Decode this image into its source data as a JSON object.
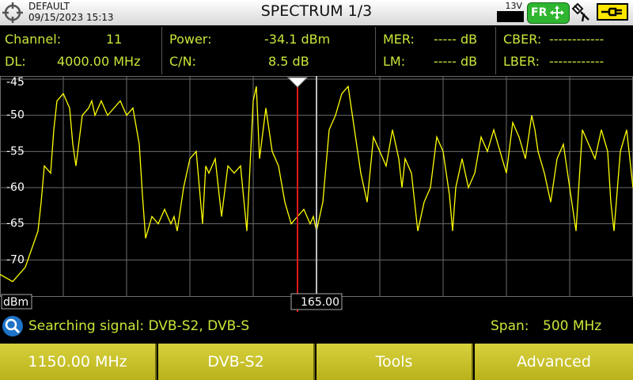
{
  "header": {
    "profile": "DEFAULT",
    "datetime": "09/15/2023 15:13",
    "title": "SPECTRUM 1/3",
    "lnb_voltage": "13V",
    "fr_label": "FR"
  },
  "measurements": {
    "channel_label": "Channel:",
    "channel_value": "11",
    "dl_label": "DL:",
    "dl_value": "4000.00 MHz",
    "power_label": "Power:",
    "power_value": "-34.1 dBm",
    "cn_label": "C/N:",
    "cn_value": "8.5 dB",
    "mer_label": "MER:",
    "mer_value": "----- dB",
    "lm_label": "LM:",
    "lm_value": "----- dB",
    "cber_label": "CBER:",
    "cber_value": "------------",
    "lber_label": "LBER:",
    "lber_value": "------------"
  },
  "chart_data": {
    "type": "line",
    "ylabel": "dBm",
    "ylim": [
      -75,
      -45
    ],
    "yticks": [
      -45,
      -50,
      -55,
      -60,
      -65,
      -70
    ],
    "cursor_value": "165.00",
    "x": [
      0,
      2,
      4,
      6,
      6.5,
      7,
      8,
      8.5,
      9,
      10,
      11,
      11.5,
      12,
      13,
      14,
      14.5,
      15,
      15.5,
      16,
      17,
      18,
      19,
      20,
      21,
      22,
      22.5,
      23,
      24,
      25,
      25.5,
      26,
      27,
      27.5,
      28,
      29,
      30,
      31,
      32,
      32.5,
      33,
      34,
      35,
      36,
      37,
      38,
      39,
      40,
      40.5,
      41,
      42,
      43,
      44,
      45,
      46,
      47,
      48,
      49,
      49.5,
      50,
      51,
      52,
      53,
      54,
      55,
      55.5,
      56,
      57,
      58,
      59,
      60,
      61,
      62,
      63,
      63.5,
      64,
      65,
      66,
      67,
      68,
      69,
      70,
      71,
      71.5,
      72,
      73,
      74,
      75,
      76,
      77,
      78,
      79,
      80,
      81,
      82,
      83,
      84,
      84.5,
      85,
      86,
      87,
      88,
      89,
      90,
      91,
      92,
      93,
      94,
      95,
      96,
      96.5,
      97,
      98,
      99,
      100
    ],
    "y": [
      -72,
      -73,
      -71,
      -66,
      -62,
      -57,
      -58,
      -52,
      -48,
      -47,
      -49,
      -54,
      -57,
      -50,
      -49,
      -48,
      -50,
      -49,
      -48,
      -50,
      -49,
      -48,
      -50,
      -49,
      -54,
      -61,
      -67,
      -64,
      -65,
      -64,
      -63,
      -65,
      -64,
      -66,
      -60,
      -56,
      -55,
      -65,
      -57,
      -58,
      -56,
      -64,
      -57,
      -58,
      -57,
      -66,
      -48,
      -46,
      -56,
      -49,
      -55,
      -57,
      -62,
      -65,
      -64,
      -63,
      -65,
      -64,
      -66,
      -62,
      -52,
      -50,
      -47,
      -46,
      -49,
      -52,
      -58,
      -62,
      -53,
      -55,
      -57,
      -52,
      -56,
      -60,
      -56,
      -58,
      -66,
      -62,
      -60,
      -53,
      -55,
      -61,
      -66,
      -60,
      -56,
      -60,
      -58,
      -53,
      -55,
      -52,
      -55,
      -58,
      -51,
      -53,
      -56,
      -50,
      -52,
      -55,
      -58,
      -62,
      -56,
      -54,
      -60,
      -66,
      -52,
      -54,
      -56,
      -52,
      -55,
      -62,
      -66,
      -55,
      -52,
      -60
    ]
  },
  "status": {
    "search_text": "Searching signal: DVB-S2, DVB-S",
    "span_label": "Span:",
    "span_value": "500 MHz"
  },
  "softkeys": {
    "key1": "1150.00 MHz",
    "key2": "DVB-S2",
    "key3": "Tools",
    "key4": "Advanced"
  }
}
